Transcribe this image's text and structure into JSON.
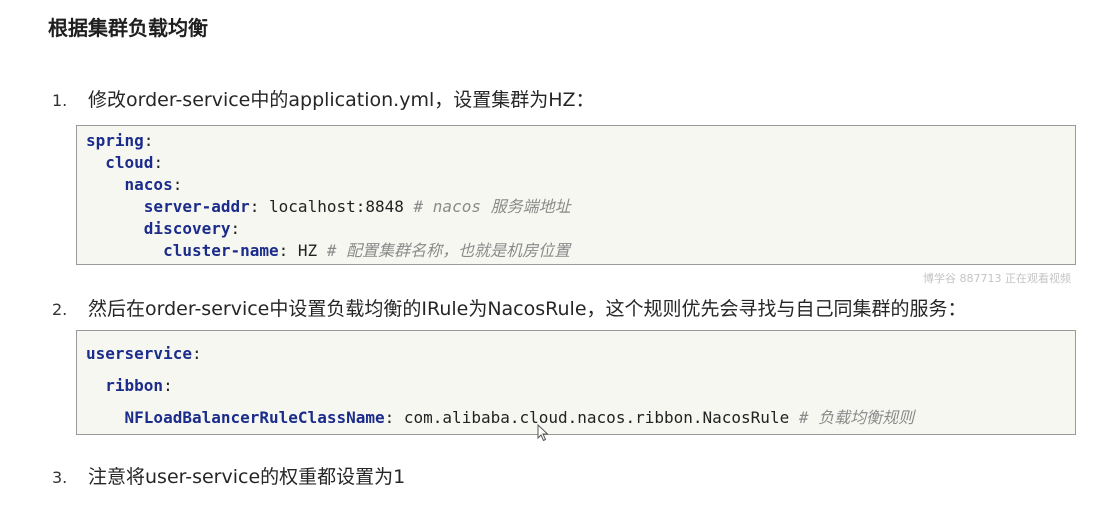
{
  "title": "根据集群负载均衡",
  "steps": [
    {
      "num": "1.",
      "text": "修改order-service中的application.yml，设置集群为HZ："
    },
    {
      "num": "2.",
      "text": "然后在order-service中设置负载均衡的IRule为NacosRule，这个规则优先会寻找与自己同集群的服务："
    },
    {
      "num": "3.",
      "text": "注意将user-service的权重都设置为1"
    }
  ],
  "code1": {
    "spring_key": "spring",
    "cloud_key": "cloud",
    "nacos_key": "nacos",
    "server_addr_key": "server-addr",
    "server_addr_value": "localhost:8848",
    "server_addr_comment": "# nacos 服务端地址",
    "discovery_key": "discovery",
    "cluster_name_key": "cluster-name",
    "cluster_name_value": "HZ",
    "cluster_name_comment": "# 配置集群名称，也就是机房位置"
  },
  "code2": {
    "userservice_key": "userservice",
    "ribbon_key": "ribbon",
    "rule_key": "NFLoadBalancerRuleClassName",
    "rule_value": "com.alibaba.cloud.nacos.ribbon.NacosRule",
    "rule_comment": "# 负载均衡规则"
  },
  "watermark": "博学谷 887713 正在观看视频"
}
